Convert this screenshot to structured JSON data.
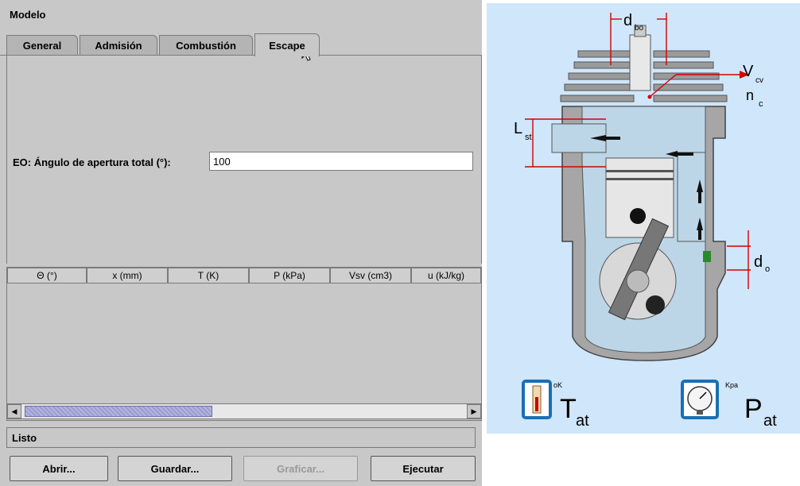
{
  "window": {
    "title": "Modelo"
  },
  "tabs": [
    {
      "label": "General"
    },
    {
      "label": "Admisión"
    },
    {
      "label": "Combustión"
    },
    {
      "label": "Escape"
    }
  ],
  "form": {
    "label": "EO: Ángulo de apertura total (°):",
    "value": "100"
  },
  "table": {
    "columns": [
      "Θ (°)",
      "x (mm)",
      "T (K)",
      "P (kPa)",
      "Vsv (cm3)",
      "u (kJ/kg)"
    ]
  },
  "status": {
    "text": "Listo"
  },
  "buttons": {
    "open": "Abrir...",
    "save": "Guardar...",
    "plot": "Graficar...",
    "run": "Ejecutar"
  },
  "diagram": {
    "labels": {
      "d": "d",
      "d_sub": "bo",
      "V": "V",
      "V_sub": "cv",
      "n": "n",
      "n_sub": "c",
      "L": "L",
      "L_sub": "st",
      "do": "d",
      "do_sub": "o",
      "T": "T",
      "T_sub": "at",
      "T_unit": "oK",
      "P": "P",
      "P_sub": "at",
      "P_unit": "Kpa"
    },
    "colors": {
      "background": "#cfe6fb",
      "gas": "#a8cbe0",
      "metal": "#8c8c8c",
      "arrow": "#d40000"
    }
  }
}
